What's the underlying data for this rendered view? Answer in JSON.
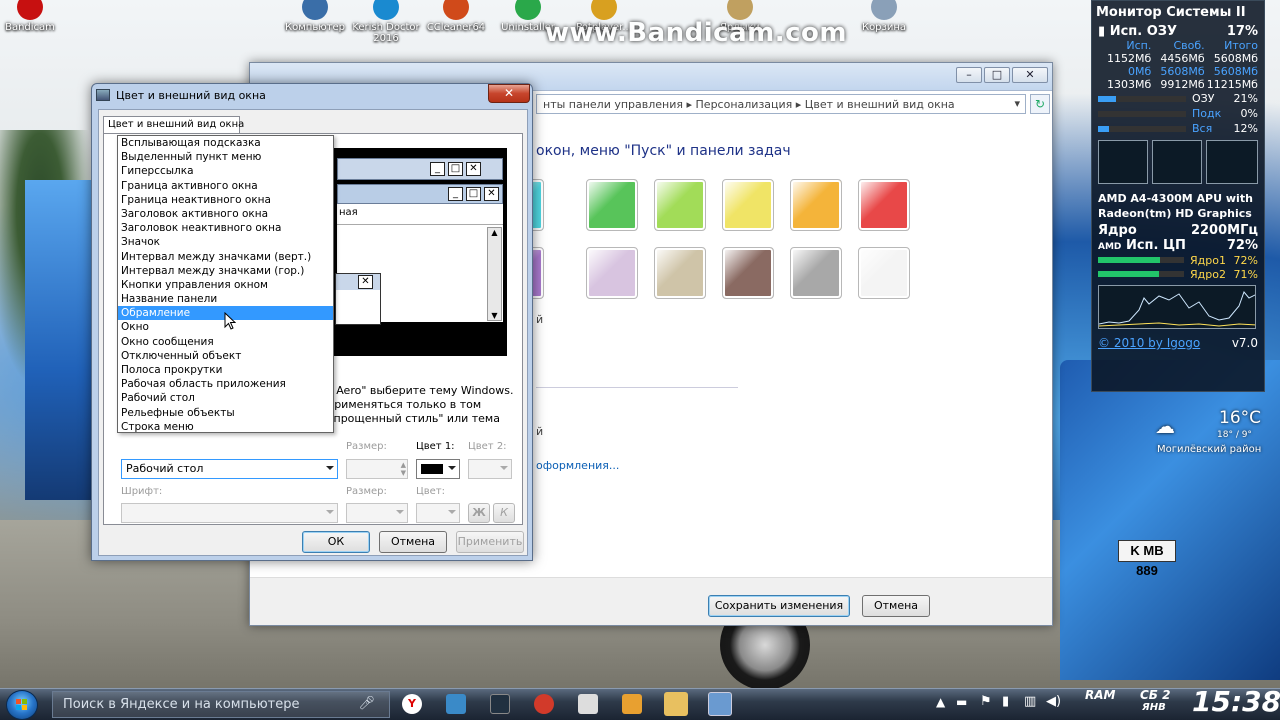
{
  "watermark": "www.Bandicam.com",
  "desktop_icons": [
    {
      "label": "Bandicam",
      "icon": "bandicam-icon",
      "color": "#c71010"
    },
    {
      "label": "Компьютер",
      "icon": "computer-icon",
      "color": "#3a6ea8"
    },
    {
      "label": "Kerish Doctor 2016",
      "icon": "kerish-doctor-icon",
      "color": "#1a8ad0"
    },
    {
      "label": "CCleaner64",
      "icon": "ccleaner-icon",
      "color": "#d04a1a"
    },
    {
      "label": "Uninstaller",
      "icon": "uninstaller-icon",
      "color": "#2aa84a"
    },
    {
      "label": "Potplayer...",
      "icon": "potplayer-icon",
      "color": "#d8a020"
    },
    {
      "label": "Ярлыки",
      "icon": "shortcuts-icon",
      "color": "#c0a060"
    },
    {
      "label": "Корзина",
      "icon": "recycle-bin-icon",
      "color": "#8aa0b8"
    }
  ],
  "sysmon": {
    "title": "Монитор Системы II",
    "ram_label": "Исп. ОЗУ",
    "ram_value": "17%",
    "cols": [
      "Исп.",
      "Своб.",
      "Итого"
    ],
    "rows": [
      [
        "1152Мб",
        "4456Мб",
        "5608Мб"
      ],
      [
        "0Мб",
        "5608Мб",
        "5608Мб"
      ],
      [
        "1303Мб",
        "9912Мб",
        "11215Мб"
      ]
    ],
    "bars": [
      {
        "label": "ОЗУ",
        "value": "21%",
        "pct": 21
      },
      {
        "label": "Подк",
        "value": "0%",
        "pct": 0
      },
      {
        "label": "Вся",
        "value": "12%",
        "pct": 12
      }
    ],
    "cpu_name": "AMD A4-4300M APU with Radeon(tm) HD Graphics",
    "core_label": "Ядро",
    "core_value": "2200МГц",
    "cpu_use_label": "Исп. ЦП",
    "cpu_use_value": "72%",
    "cores": [
      {
        "label": "Ядро1",
        "value": "72%",
        "pct": 72
      },
      {
        "label": "Ядро2",
        "value": "71%",
        "pct": 71
      }
    ],
    "credit": "© 2010 by Igogo",
    "version": "v7.0",
    "amd": "AMD"
  },
  "weather": {
    "temp": "16°C",
    "range": "18° / 9°",
    "location": "Могилёвский район"
  },
  "backwin": {
    "address": "нты панели управления  ▸  Персонализация  ▸  Цвет и внешний вид окна",
    "heading": "окон, меню \"Пуск\" и панели задач",
    "swatches_row1": [
      "#4fd6e0",
      "#58c45a",
      "#a2dc58",
      "#f0e466",
      "#f4b43a",
      "#e84848"
    ],
    "swatches_row2": [
      "#a878cc",
      "#d8c4e0",
      "#cfc4a8",
      "#8a6a62",
      "#a8a8a8",
      "#f4f4f4"
    ],
    "partial_text": "й",
    "link": "оформления...",
    "save_label": "Сохранить изменения",
    "cancel_label": "Отмена"
  },
  "dialog": {
    "title": "Цвет и внешний вид окна",
    "tab": "Цвет и внешний вид окна",
    "preview_partial_label": "ная",
    "items": [
      "Всплывающая подсказка",
      "Выделенный пункт меню",
      "Гиперссылка",
      "Граница активного окна",
      "Граница неактивного окна",
      "Заголовок активного окна",
      "Заголовок неактивного окна",
      "Значок",
      "Интервал между значками (верт.)",
      "Интервал между значками (гор.)",
      "Кнопки управления окном",
      "Название панели",
      "Обрамление",
      "Окно",
      "Окно сообщения",
      "Отключенный объект",
      "Полоса прокрутки",
      "Рабочая область приложения",
      "Рабочий стол",
      "Рельефные объекты",
      "Строка меню"
    ],
    "selected_index": 12,
    "desc": "s Aero\" выберите тему Windows. применяться только в том упрощенный стиль\" или тема",
    "item_value": "Рабочий стол",
    "size_label": "Размер:",
    "color1_label": "Цвет 1:",
    "color2_label": "Цвет 2:",
    "font_label": "Шрифт:",
    "font_size_label": "Размер:",
    "font_color_label": "Цвет:",
    "bold_label": "Ж",
    "italic_label": "К",
    "color1_value": "#000000",
    "ok_label": "ОК",
    "cancel_label": "Отмена",
    "apply_label": "Применить"
  },
  "taskbar": {
    "search_placeholder": "Поиск в Яндексе и на компьютере",
    "ram_label": "RAM",
    "date_day": "СБ",
    "date_num": "2",
    "date_month": "ЯНВ",
    "time": "15:38"
  }
}
